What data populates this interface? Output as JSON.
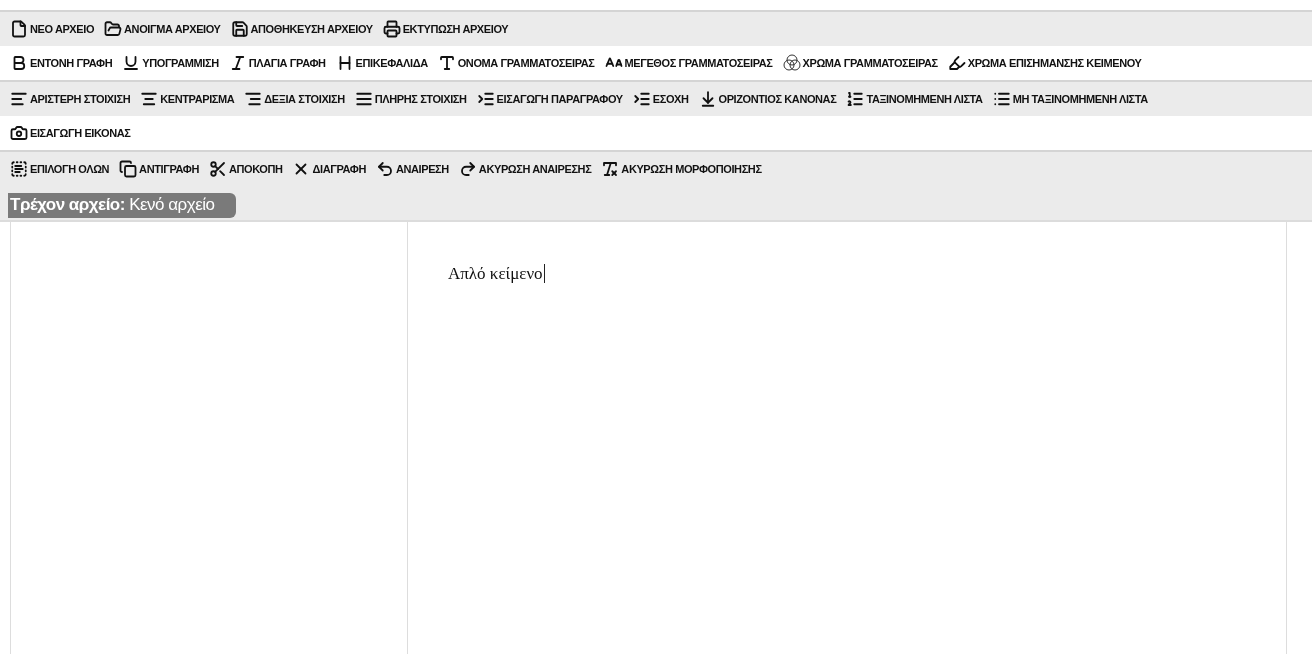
{
  "toolbars": [
    {
      "items": [
        {
          "label": "ΝΕΟ ΑΡΧΕΙΟ"
        },
        {
          "label": "ΑΝΟΙΓΜΑ ΑΡΧΕΙΟΥ"
        },
        {
          "label": "ΑΠΟΘΗΚΕΥΣΗ ΑΡΧΕΙΟΥ"
        },
        {
          "label": "ΕΚΤΥΠΩΣΗ ΑΡΧΕΙΟΥ"
        }
      ]
    },
    {
      "items": [
        {
          "label": "ΕΝΤΟΝΗ ΓΡΑΦΗ"
        },
        {
          "label": "ΥΠΟΓΡΑΜΜΙΣΗ"
        },
        {
          "label": "ΠΛΑΓΙΑ ΓΡΑΦΗ"
        },
        {
          "label": "ΕΠΙΚΕΦΑΛΙΔΑ"
        },
        {
          "label": "ΟΝΟΜΑ ΓΡΑΜΜΑΤΟΣΕΙΡΑΣ"
        },
        {
          "label": "ΜΕΓΕΘΟΣ ΓΡΑΜΜΑΤΟΣΕΙΡΑΣ"
        },
        {
          "label": "ΧΡΩΜΑ ΓΡΑΜΜΑΤΟΣΕΙΡΑΣ"
        },
        {
          "label": "ΧΡΩΜΑ ΕΠΙΣΗΜΑΝΣΗΣ ΚΕΙΜΕΝΟΥ"
        }
      ]
    },
    {
      "items": [
        {
          "label": "ΑΡΙΣΤΕΡΗ ΣΤΟΙΧΙΣΗ"
        },
        {
          "label": "ΚΕΝΤΡΑΡΙΣΜΑ"
        },
        {
          "label": "ΔΕΞΙΑ ΣΤΟΙΧΙΣΗ"
        },
        {
          "label": "ΠΛΗΡΗΣ ΣΤΟΙΧΙΣΗ"
        },
        {
          "label": "ΕΙΣΑΓΩΓΗ ΠΑΡΑΓΡΑΦΟΥ"
        },
        {
          "label": "ΕΣΟΧΗ"
        },
        {
          "label": "ΟΡΙΖΟΝΤΙΟΣ ΚΑΝΟΝΑΣ"
        },
        {
          "label": "ΤΑΞΙΝΟΜΗΜΕΝΗ ΛΙΣΤΑ"
        },
        {
          "label": "ΜΗ ΤΑΞΙΝΟΜΗΜΕΝΗ ΛΙΣΤΑ"
        }
      ]
    },
    {
      "items": [
        {
          "label": "ΕΙΣΑΓΩΓΗ ΕΙΚΟΝΑΣ"
        }
      ]
    },
    {
      "items": [
        {
          "label": "ΕΠΙΛΟΓΗ ΟΛΩΝ"
        },
        {
          "label": "ΑΝΤΙΓΡΑΦΗ"
        },
        {
          "label": "ΑΠΟΚΟΠΗ"
        },
        {
          "label": "ΔΙΑΓΡΑΦΗ"
        },
        {
          "label": "ΑΝΑΙΡΕΣΗ"
        },
        {
          "label": "ΑΚΥΡΩΣΗ ΑΝΑΙΡΕΣΗΣ"
        },
        {
          "label": "ΑΚΥΡΩΣΗ ΜΟΡΦΟΠΟΙΗΣΗΣ"
        }
      ]
    }
  ],
  "current_file": {
    "text": "**Τρέχον αρχείο:** Κενό αρχείο"
  },
  "editor": {
    "text": "Απλό κείμενο"
  }
}
